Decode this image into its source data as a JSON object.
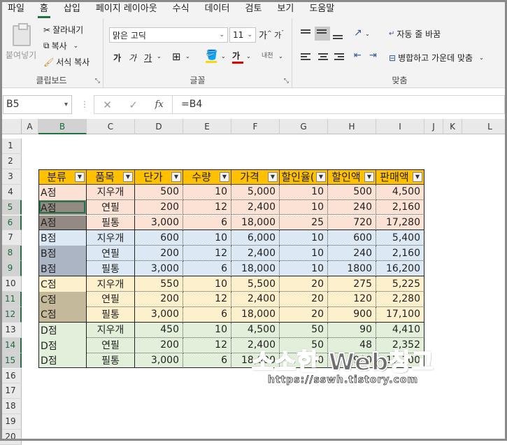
{
  "menu": [
    "파일",
    "홈",
    "삽입",
    "페이지 레이아웃",
    "수식",
    "데이터",
    "검토",
    "보기",
    "도움말"
  ],
  "active_menu_index": 1,
  "ribbon": {
    "clipboard": {
      "paste": "붙여넣기",
      "cut": "잘라내기",
      "copy": "복사",
      "format_painter": "서식 복사",
      "label": "클립보드"
    },
    "font": {
      "font_name": "맑은 고딕",
      "font_size": "11",
      "grow": "가",
      "shrink": "가",
      "bold": "가",
      "italic": "가",
      "underline": "가",
      "highlight_char": "가",
      "phonetic": "내천",
      "label": "글꼴"
    },
    "alignment": {
      "wrap_text": "자동 줄 바꿈",
      "merge_center": "병합하고 가운데 맞춤",
      "label": "맞춤"
    }
  },
  "formula_bar": {
    "name_box": "B5",
    "cancel": "✕",
    "enter": "✓",
    "fx": "fx",
    "formula": "=B4"
  },
  "columns": [
    "A",
    "B",
    "C",
    "D",
    "E",
    "F",
    "G",
    "H",
    "I",
    "J",
    "K",
    "L"
  ],
  "rows": [
    "1",
    "2",
    "3",
    "4",
    "5",
    "6",
    "7",
    "8",
    "9",
    "10",
    "11",
    "12",
    "13",
    "14",
    "15",
    "16",
    "17",
    "18",
    "19",
    "20"
  ],
  "selected_column": "B",
  "selected_rows": [
    "5",
    "6",
    "8",
    "9",
    "11",
    "12",
    "14",
    "15"
  ],
  "table": {
    "headers": [
      "분류",
      "품목",
      "단가",
      "수량",
      "가격",
      "할인율(",
      "할인액",
      "판매액"
    ],
    "filter_glyph": "▼",
    "rows": [
      [
        "A점",
        "지우개",
        "500",
        "10",
        "5,000",
        "10",
        "500",
        "4,500"
      ],
      [
        "A점",
        "연필",
        "200",
        "12",
        "2,400",
        "10",
        "240",
        "2,160"
      ],
      [
        "A점",
        "필통",
        "3,000",
        "6",
        "18,000",
        "25",
        "720",
        "17,280"
      ],
      [
        "B점",
        "지우개",
        "600",
        "10",
        "6,000",
        "10",
        "600",
        "5,400"
      ],
      [
        "B점",
        "연필",
        "200",
        "12",
        "2,400",
        "10",
        "240",
        "2,160"
      ],
      [
        "B점",
        "필통",
        "3,000",
        "6",
        "18,000",
        "10",
        "1800",
        "16,200"
      ],
      [
        "C점",
        "지우개",
        "550",
        "10",
        "5,500",
        "20",
        "275",
        "5,225"
      ],
      [
        "C점",
        "연필",
        "200",
        "12",
        "2,400",
        "20",
        "120",
        "2,280"
      ],
      [
        "C점",
        "필통",
        "3,000",
        "6",
        "18,000",
        "20",
        "900",
        "17,100"
      ],
      [
        "D점",
        "지우개",
        "450",
        "10",
        "4,500",
        "50",
        "90",
        "4,410"
      ],
      [
        "D점",
        "연필",
        "200",
        "12",
        "2,400",
        "50",
        "48",
        "2,352"
      ],
      [
        "D점",
        "필통",
        "3,000",
        "6",
        "18,000",
        "50",
        "900",
        "17,100"
      ]
    ],
    "group_colors": [
      "#fbe2d5",
      "#dde8f5",
      "#fdf0cc",
      "#e2efda"
    ],
    "selected_b_colors": [
      "#948a84",
      "#acb5c4",
      "#c4b99a",
      "#e2efda"
    ],
    "header_color": "#ffc000"
  },
  "watermark": {
    "title": "소소한 Web창고",
    "url": "https://sswh.tistory.com"
  }
}
